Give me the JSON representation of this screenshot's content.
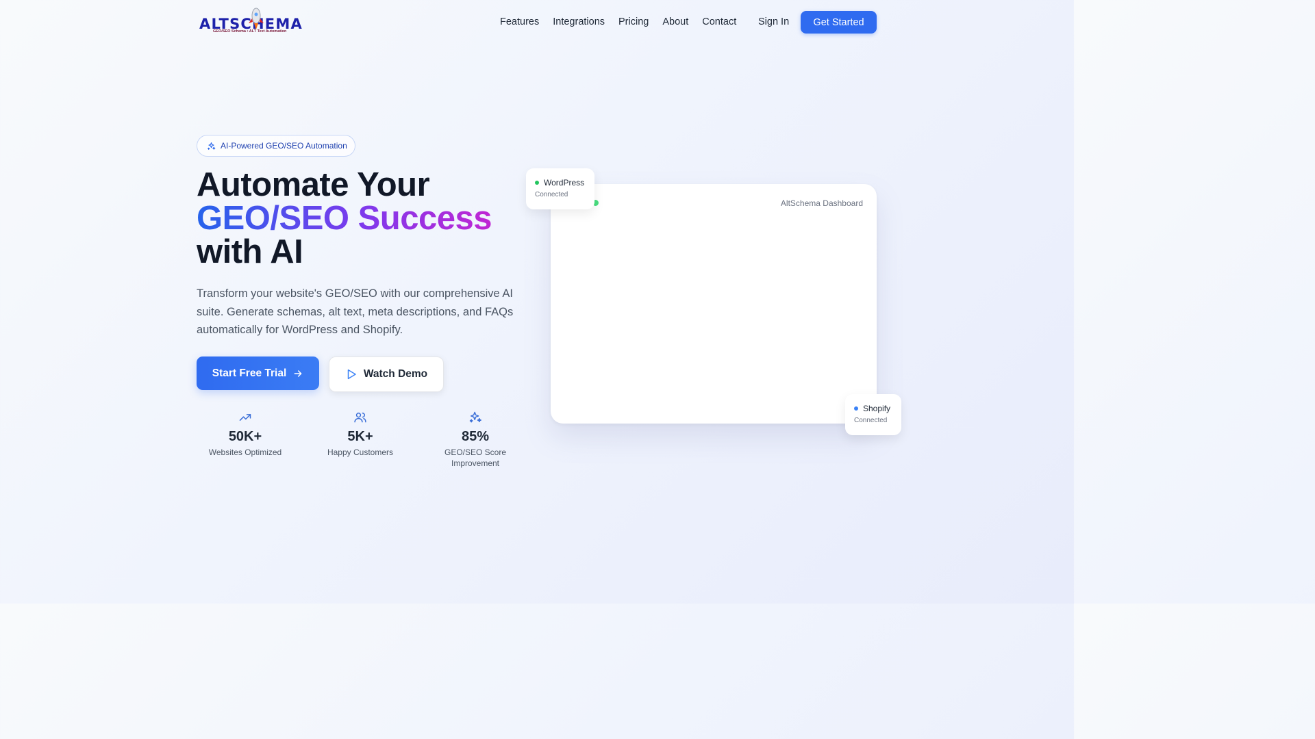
{
  "brand": {
    "logo_prefix": "ALTSC",
    "logo_suffix": "HEMA",
    "tagline": "GEO/SEO Schema • ALT Text Automation"
  },
  "nav": {
    "links": [
      "Features",
      "Integrations",
      "Pricing",
      "About",
      "Contact"
    ],
    "signin": "Sign In",
    "cta": "Get Started"
  },
  "hero": {
    "badge": "AI-Powered GEO/SEO Automation",
    "headline_line1": "Automate Your",
    "headline_grad": "GEO/SEO Success",
    "headline_line3": "with AI",
    "description": "Transform your website's GEO/SEO with our comprehensive AI suite. Generate schemas, alt text, meta descriptions, and FAQs automatically for WordPress and Shopify.",
    "primary_button": "Start Free Trial",
    "secondary_button": "Watch Demo"
  },
  "stats": [
    {
      "icon": "trending-up-icon",
      "value": "50K+",
      "label": "Websites Optimized"
    },
    {
      "icon": "users-icon",
      "value": "5K+",
      "label": "Happy Customers"
    },
    {
      "icon": "sparkles-icon",
      "value": "85%",
      "label": "GEO/SEO Score Improvement"
    }
  ],
  "dashboard": {
    "title": "AltSchema Dashboard",
    "integrations": [
      {
        "name": "WordPress",
        "status": "Connected",
        "dot_color": "#22c55e"
      },
      {
        "name": "Shopify",
        "status": "Connected",
        "dot_color": "#3b82f6"
      }
    ]
  },
  "colors": {
    "accent": "#2f6bf0",
    "gradient_start": "#2563eb",
    "gradient_end": "#c026d3"
  }
}
